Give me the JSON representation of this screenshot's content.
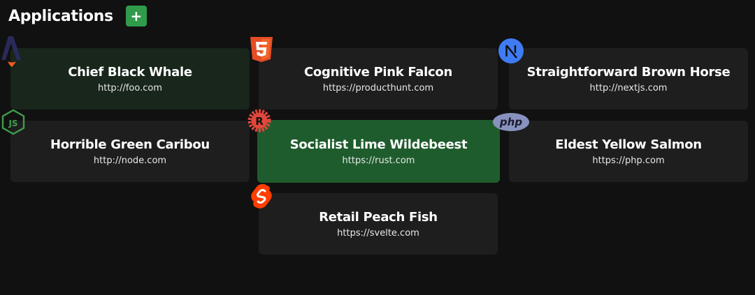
{
  "header": {
    "title": "Applications",
    "add_label": "+"
  },
  "apps": [
    {
      "name": "Chief Black Whale",
      "url": "http://foo.com",
      "icon": "astro-icon"
    },
    {
      "name": "Cognitive Pink Falcon",
      "url": "https://producthunt.com",
      "icon": "html5-icon"
    },
    {
      "name": "Straightforward Brown Horse",
      "url": "http://nextjs.com",
      "icon": "nextjs-icon"
    },
    {
      "name": "Horrible Green Caribou",
      "url": "http://node.com",
      "icon": "nodejs-icon"
    },
    {
      "name": "Socialist Lime Wildebeest",
      "url": "https://rust.com",
      "icon": "rust-icon"
    },
    {
      "name": "Eldest Yellow Salmon",
      "url": "https://php.com",
      "icon": "php-icon"
    },
    {
      "name": "Retail Peach Fish",
      "url": "https://svelte.com",
      "icon": "svelte-icon"
    }
  ],
  "colors": {
    "background": "#111111",
    "card": "#1e1e1e",
    "selected_card": "#1f5c2d",
    "add_button": "#2f9b4b"
  }
}
